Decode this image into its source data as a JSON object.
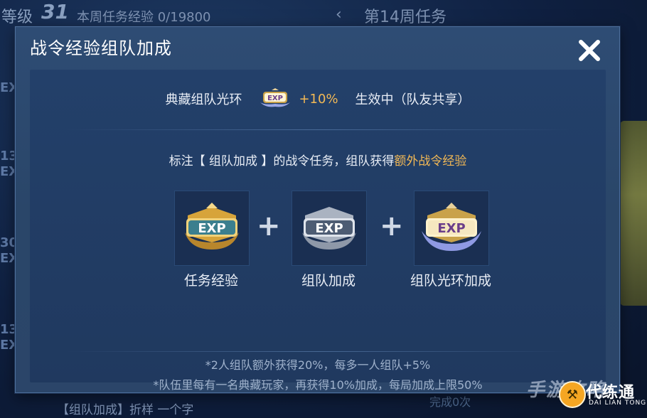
{
  "background": {
    "level_label": "等级",
    "level_value": "31",
    "weekly_exp": "本周任务经验 0/19800",
    "week_title": "第14周任务",
    "left_items": [
      "EX",
      "13",
      "EX",
      "30",
      "EX",
      "13",
      "EX"
    ],
    "bottom_left_text": "【组队加成】折样 一个字",
    "bottom_right_text": "完成0次"
  },
  "dialog": {
    "title": "战令经验组队加成",
    "aura": {
      "label": "典藏组队光环",
      "icon": "exp-aura-badge-icon",
      "bonus": "+10%",
      "status": "生效中（队友共享）"
    },
    "note_prefix": "标注【 组队加成 】的战令任务，组队获得",
    "note_highlight": "额外战令经验",
    "cards": [
      {
        "label": "任务经验",
        "icon": "exp-gold-badge-icon"
      },
      {
        "label": "组队加成",
        "icon": "exp-silver-badge-icon"
      },
      {
        "label": "组队光环加成",
        "icon": "exp-aura-badge-icon"
      }
    ],
    "plus_symbol": "+",
    "footnotes": [
      "*2人组队额外获得20%，每多一人组队+5%",
      "*队伍里每有一名典藏玩家，再获得10%加成，每局加成上限50%"
    ]
  },
  "watermark": {
    "text": "手游攻略",
    "brand": "代练通",
    "brand_sub": "DAI LIAN TONG"
  },
  "colors": {
    "accent_orange": "#f3b955",
    "text_main": "#e9eef6",
    "text_muted": "#9fb2cc"
  }
}
